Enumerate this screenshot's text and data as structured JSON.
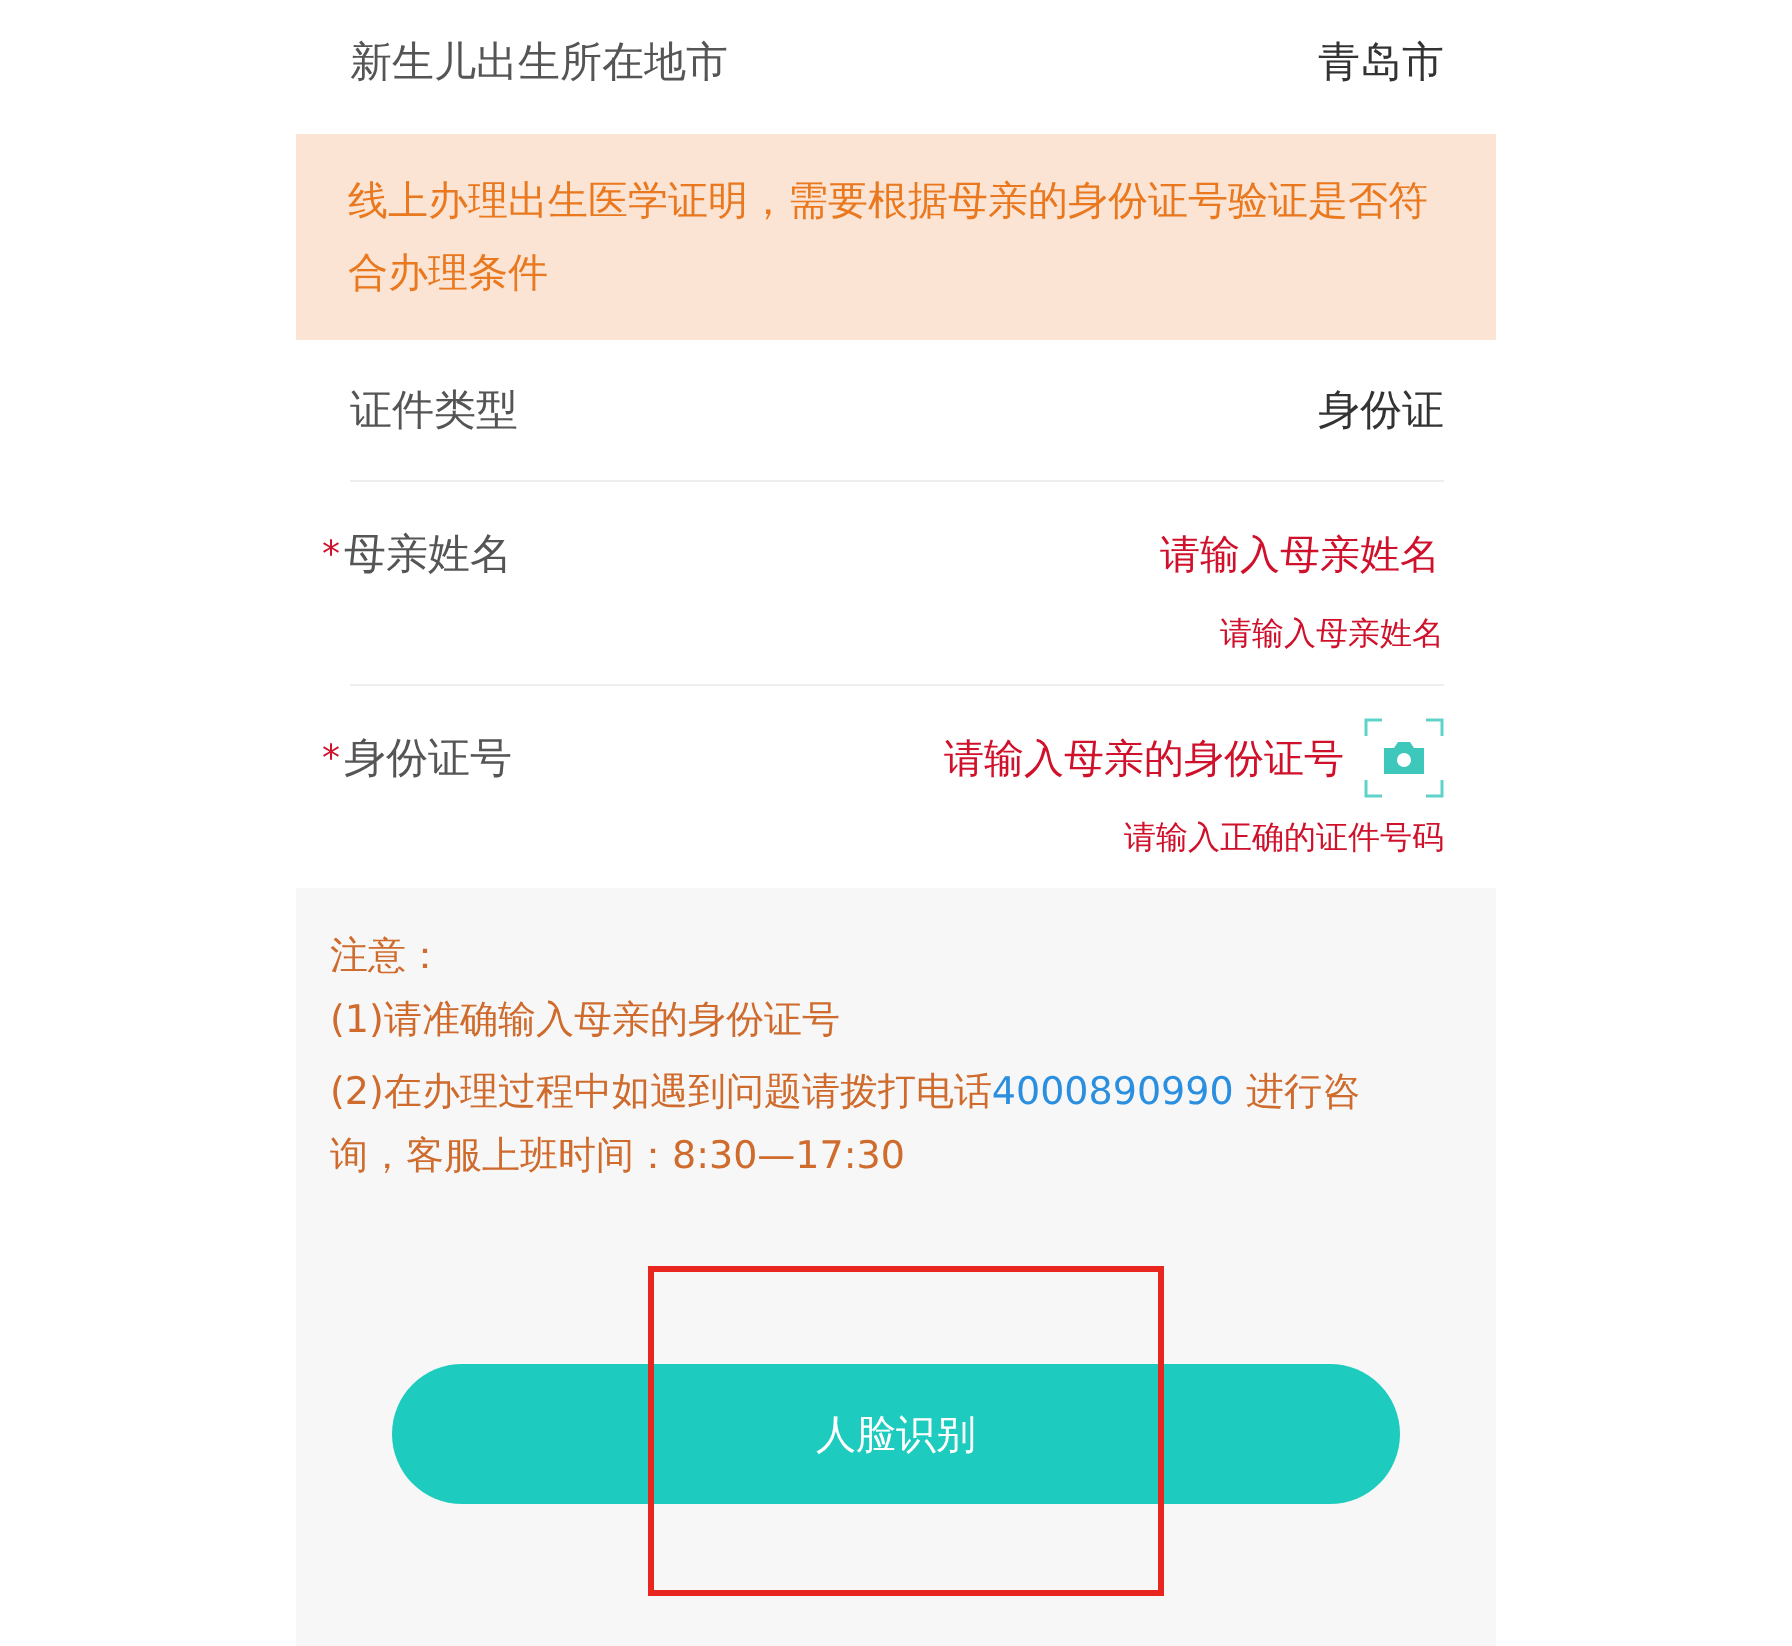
{
  "top_row": {
    "label": "新生儿出生所在地市",
    "value": "青岛市"
  },
  "banner": {
    "text": "线上办理出生医学证明，需要根据母亲的身份证号验证是否符合办理条件"
  },
  "id_type": {
    "label": "证件类型",
    "value": "身份证"
  },
  "fields": [
    {
      "mark": "*",
      "label": "母亲姓名",
      "placeholder": "请输入母亲姓名",
      "error": "请输入母亲姓名",
      "has_scan": false
    },
    {
      "mark": "*",
      "label": "身份证号",
      "placeholder": "请输入母亲的身份证号",
      "error": "请输入正确的证件号码",
      "has_scan": true
    }
  ],
  "notes": {
    "title": "注意：",
    "items": [
      {
        "before": "(1)请准确输入母亲的身份证号"
      },
      {
        "before": "(2)在办理过程中如遇到问题请拨打电话",
        "phone": "4000890990",
        "after": " 进行咨询，客服上班时间：8:30—17:30"
      }
    ]
  },
  "button": {
    "label": "人脸识别"
  }
}
